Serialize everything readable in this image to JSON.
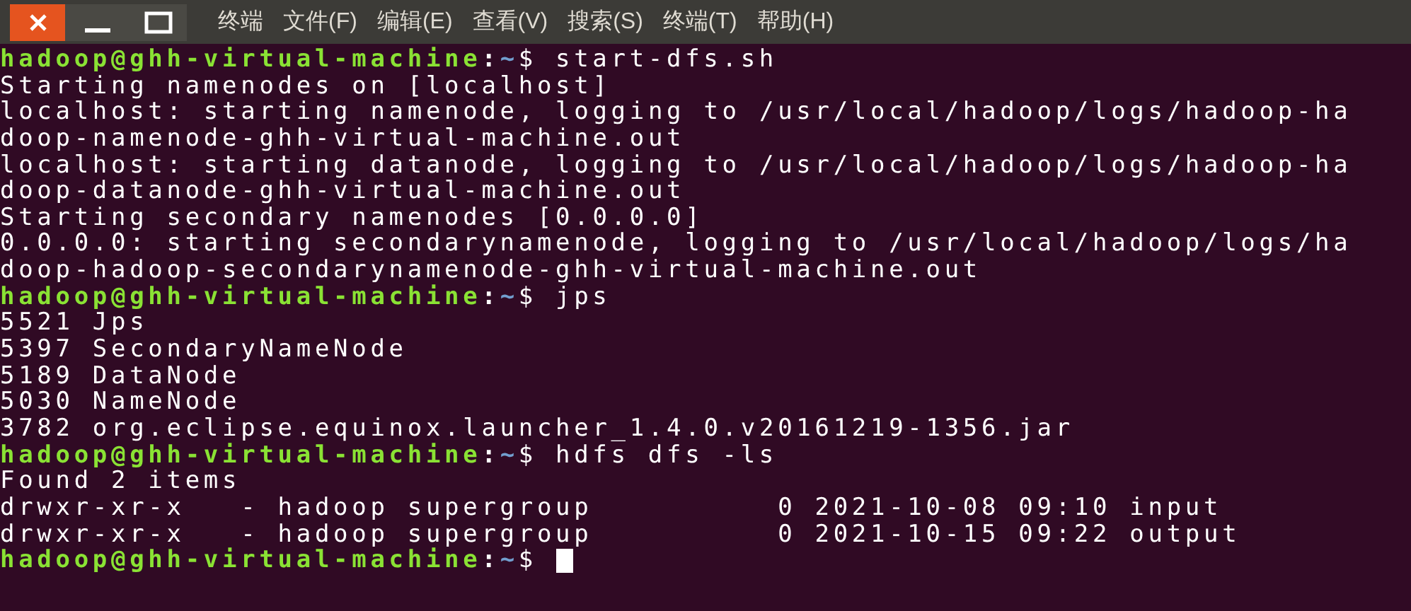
{
  "window": {
    "controls": [
      {
        "kind": "close"
      },
      {
        "kind": "minimize"
      },
      {
        "kind": "maximize"
      }
    ]
  },
  "menu": [
    "终端",
    "文件(F)",
    "编辑(E)",
    "查看(V)",
    "搜索(S)",
    "终端(T)",
    "帮助(H)"
  ],
  "terminal": {
    "lines": [
      {
        "kind": "prompt",
        "user": "hadoop@ghh-virtual-machine",
        "sep": ":",
        "path": "~",
        "symbol": "$",
        "command": "start-dfs.sh",
        "cursor": false
      },
      {
        "kind": "output",
        "text": "Starting namenodes on [localhost]"
      },
      {
        "kind": "output",
        "text": "localhost: starting namenode, logging to /usr/local/hadoop/logs/hadoop-ha"
      },
      {
        "kind": "output",
        "text": "doop-namenode-ghh-virtual-machine.out"
      },
      {
        "kind": "output",
        "text": "localhost: starting datanode, logging to /usr/local/hadoop/logs/hadoop-ha"
      },
      {
        "kind": "output",
        "text": "doop-datanode-ghh-virtual-machine.out"
      },
      {
        "kind": "output",
        "text": "Starting secondary namenodes [0.0.0.0]"
      },
      {
        "kind": "output",
        "text": "0.0.0.0: starting secondarynamenode, logging to /usr/local/hadoop/logs/ha"
      },
      {
        "kind": "output",
        "text": "doop-hadoop-secondarynamenode-ghh-virtual-machine.out"
      },
      {
        "kind": "prompt",
        "user": "hadoop@ghh-virtual-machine",
        "sep": ":",
        "path": "~",
        "symbol": "$",
        "command": "jps",
        "cursor": false
      },
      {
        "kind": "output",
        "text": "5521 Jps"
      },
      {
        "kind": "output",
        "text": "5397 SecondaryNameNode"
      },
      {
        "kind": "output",
        "text": "5189 DataNode"
      },
      {
        "kind": "output",
        "text": "5030 NameNode"
      },
      {
        "kind": "output",
        "text": "3782 org.eclipse.equinox.launcher_1.4.0.v20161219-1356.jar"
      },
      {
        "kind": "prompt",
        "user": "hadoop@ghh-virtual-machine",
        "sep": ":",
        "path": "~",
        "symbol": "$",
        "command": "hdfs dfs -ls",
        "cursor": false
      },
      {
        "kind": "output",
        "text": "Found 2 items"
      },
      {
        "kind": "output",
        "text": "drwxr-xr-x   - hadoop supergroup          0 2021-10-08 09:10 input"
      },
      {
        "kind": "output",
        "text": "drwxr-xr-x   - hadoop supergroup          0 2021-10-15 09:22 output"
      },
      {
        "kind": "prompt",
        "user": "hadoop@ghh-virtual-machine",
        "sep": ":",
        "path": "~",
        "symbol": "$",
        "cursor": true
      }
    ]
  }
}
